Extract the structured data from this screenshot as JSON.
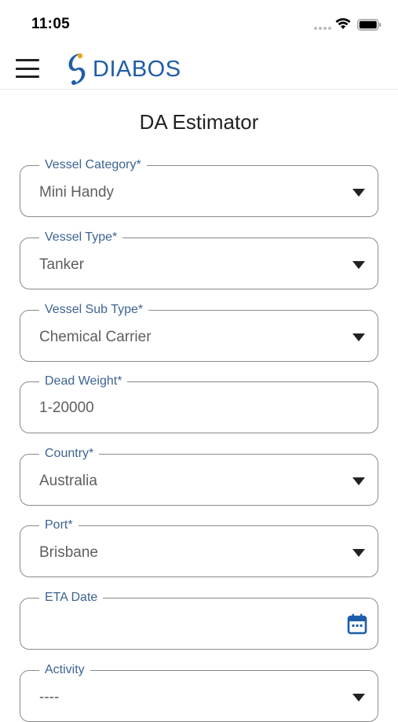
{
  "status_bar": {
    "time": "11:05"
  },
  "header": {
    "logo_text": "DIABOS",
    "brand_color": "#1f5da8"
  },
  "page": {
    "title": "DA Estimator"
  },
  "fields": [
    {
      "label": "Vessel Category*",
      "value": "Mini Handy",
      "type": "dropdown"
    },
    {
      "label": "Vessel Type*",
      "value": "Tanker",
      "type": "dropdown"
    },
    {
      "label": "Vessel Sub Type*",
      "value": "Chemical Carrier",
      "type": "dropdown"
    },
    {
      "label": "Dead Weight*",
      "value": "1-20000",
      "type": "text"
    },
    {
      "label": "Country*",
      "value": "Australia",
      "type": "dropdown"
    },
    {
      "label": "Port*",
      "value": "Brisbane",
      "type": "dropdown"
    },
    {
      "label": "ETA Date",
      "value": "",
      "type": "date",
      "icon": "calendar-icon"
    },
    {
      "label": "Activity",
      "value": "----",
      "type": "dropdown"
    }
  ],
  "colors": {
    "label": "#3d6393",
    "border": "#8a8a8a",
    "value": "#5e5e5e",
    "calendar_icon": "#1f5da8"
  }
}
